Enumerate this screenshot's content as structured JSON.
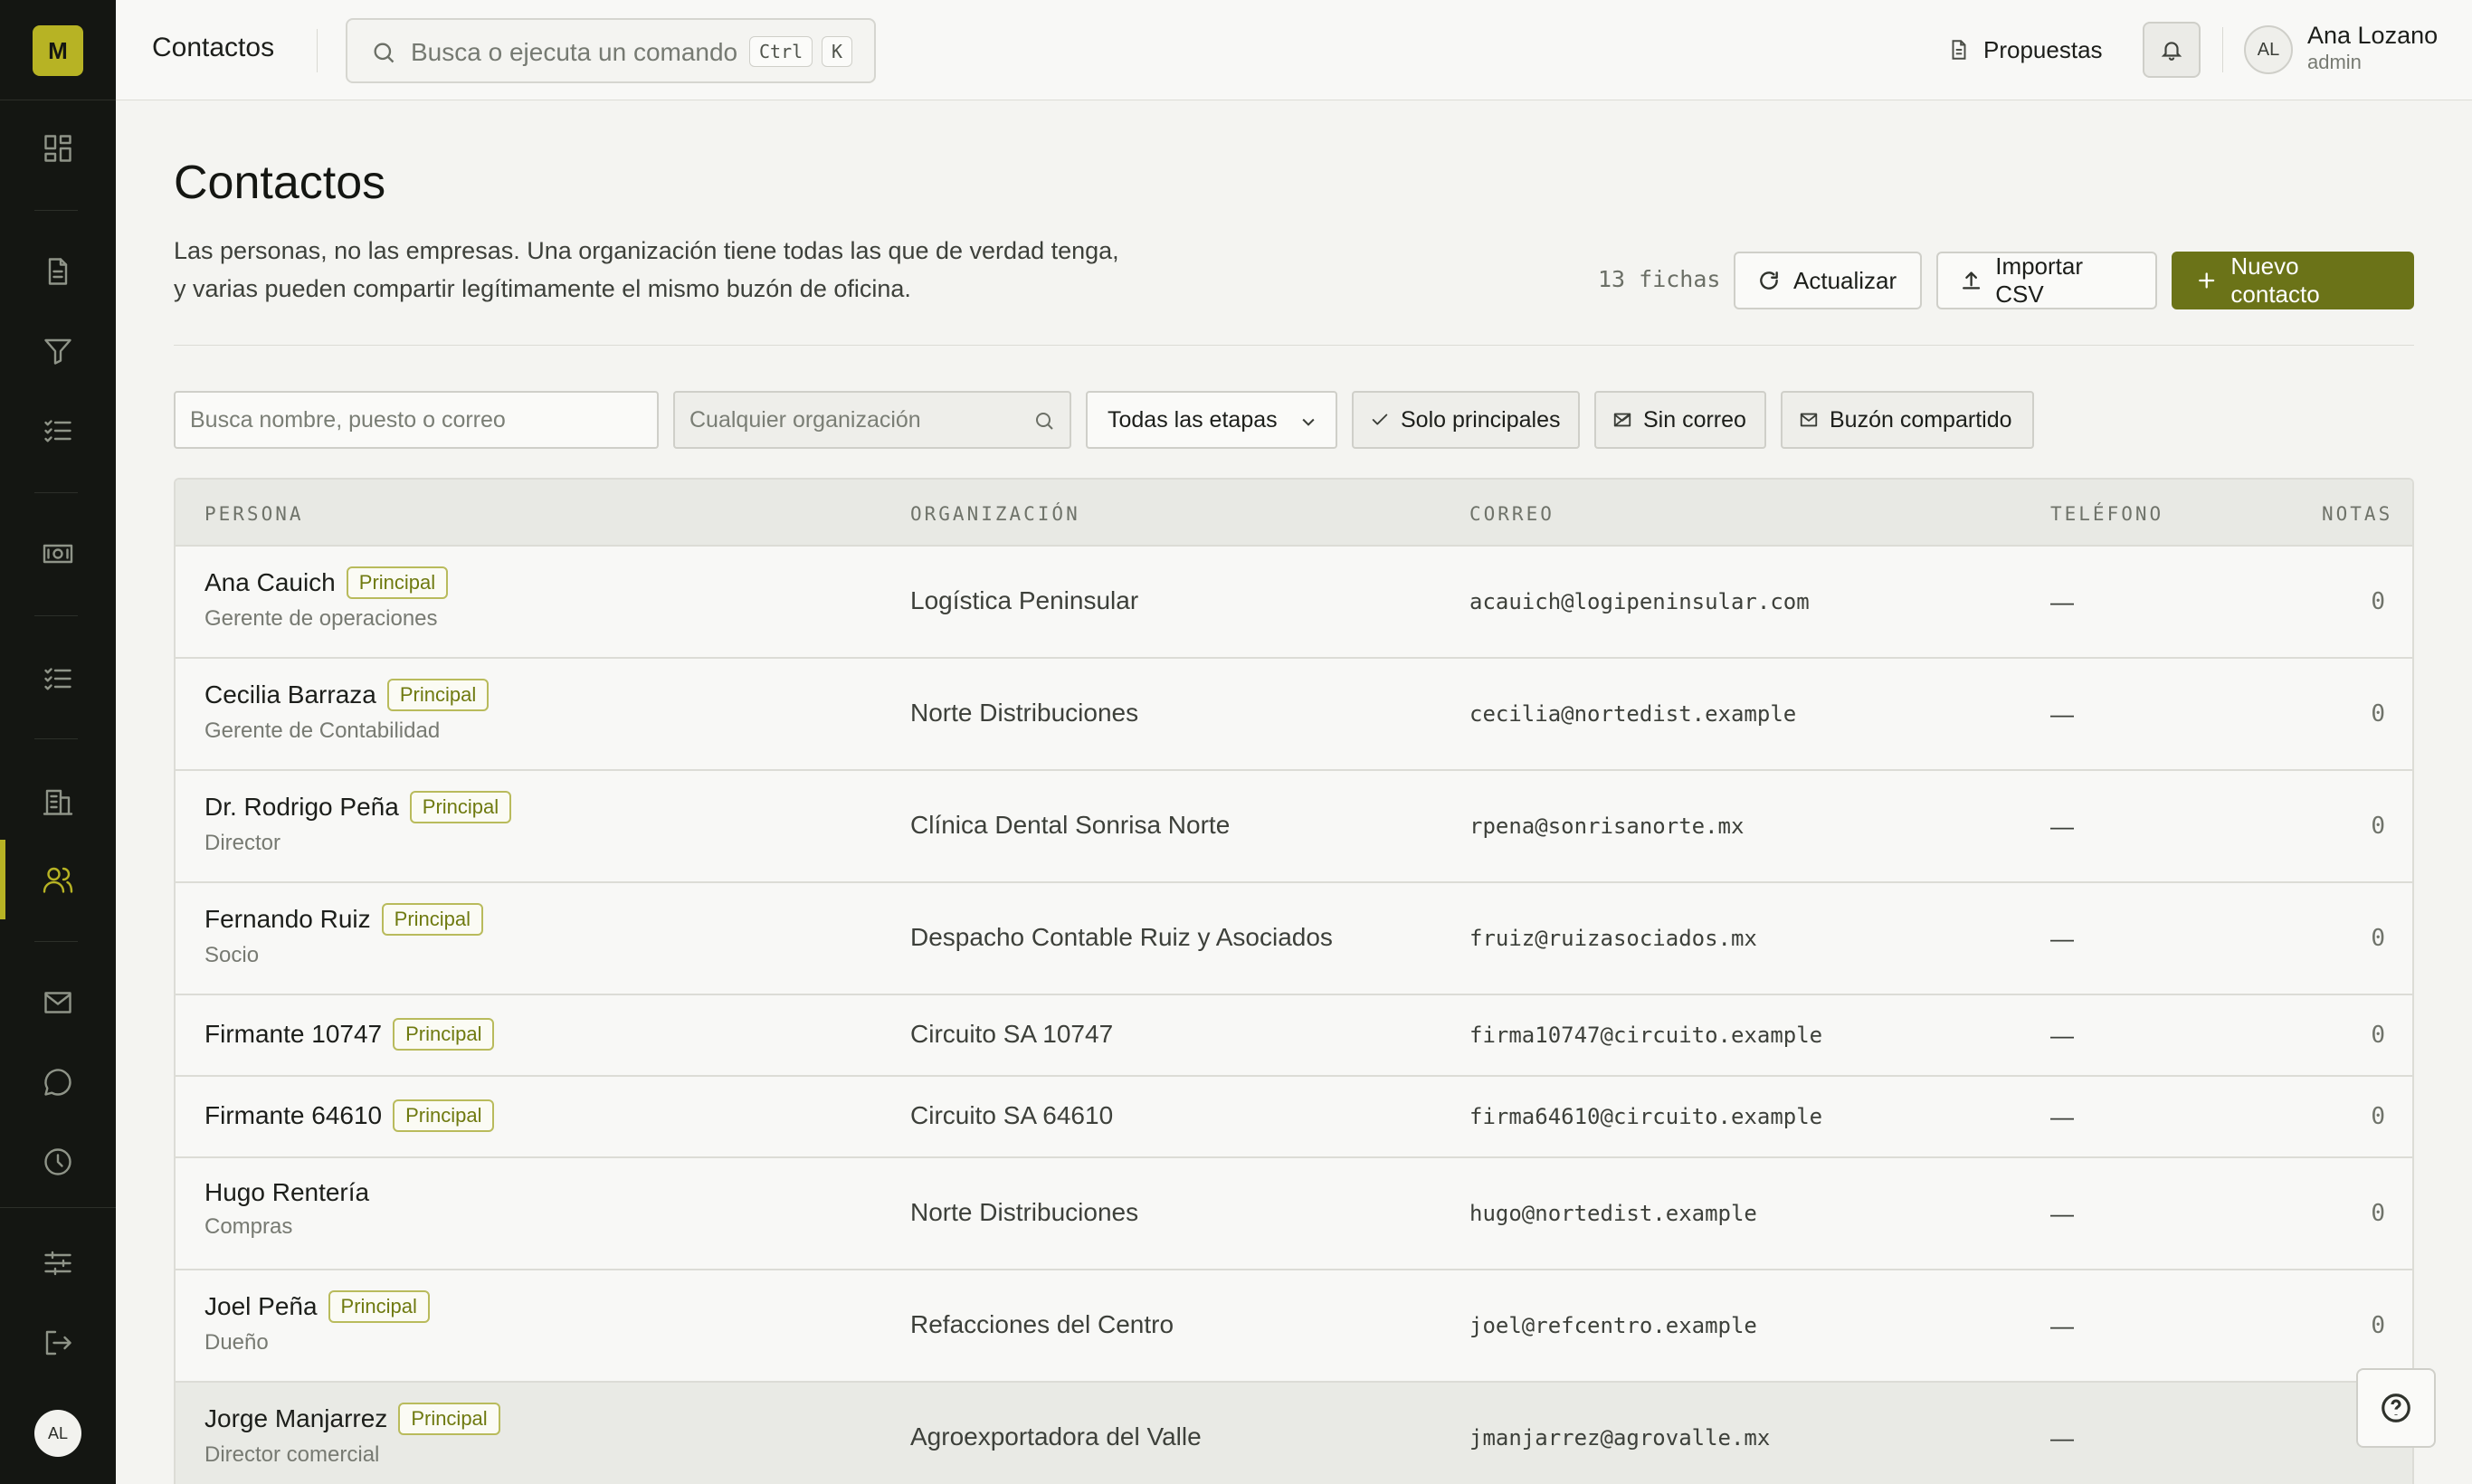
{
  "app": {
    "logo_letter": "M",
    "sidebar_avatar": "AL",
    "accent": "#b7b324",
    "primary_button_color": "#6b7318"
  },
  "sidebar": {
    "icons": [
      "dashboard-icon",
      "document-icon",
      "funnel-icon",
      "checklist-icon",
      "banknote-icon",
      "tasks-icon",
      "building-icon",
      "people-icon",
      "mail-icon",
      "chat-icon",
      "clock-icon",
      "sliders-icon",
      "logout-icon"
    ],
    "active": "people-icon"
  },
  "topbar": {
    "title": "Contactos",
    "search_placeholder": "Busca o ejecuta un comando",
    "shortcut_key1": "Ctrl",
    "shortcut_key2": "K",
    "proposals_label": "Propuestas",
    "user_initials": "AL",
    "user_name": "Ana Lozano",
    "user_role": "admin"
  },
  "page": {
    "title": "Contactos",
    "description": "Las personas, no las empresas. Una organización tiene todas las que de verdad tenga, y varias pueden compartir legítimamente el mismo buzón de oficina.",
    "count": "13 fichas",
    "refresh_label": "Actualizar",
    "import_label": "Importar CSV",
    "new_label": "Nuevo contacto"
  },
  "filters": {
    "search_placeholder": "Busca nombre, puesto o correo",
    "org_placeholder": "Cualquier organización",
    "stage_value": "Todas las etapas",
    "chip_primary": "Solo principales",
    "chip_no_email": "Sin correo",
    "chip_shared": "Buzón compartido"
  },
  "table": {
    "headers": {
      "person": "PERSONA",
      "org": "ORGANIZACIÓN",
      "email": "CORREO",
      "phone": "TELÉFONO",
      "notes": "NOTAS"
    },
    "badge_label": "Principal",
    "rows": [
      {
        "name": "Ana Cauich",
        "principal": true,
        "title": "Gerente de operaciones",
        "org": "Logística Peninsular",
        "email": "acauich@logipeninsular.com",
        "phone": "—",
        "notes": "0"
      },
      {
        "name": "Cecilia Barraza",
        "principal": true,
        "title": "Gerente de Contabilidad",
        "org": "Norte Distribuciones",
        "email": "cecilia@nortedist.example",
        "phone": "—",
        "notes": "0"
      },
      {
        "name": "Dr. Rodrigo Peña",
        "principal": true,
        "title": "Director",
        "org": "Clínica Dental Sonrisa Norte",
        "email": "rpena@sonrisanorte.mx",
        "phone": "—",
        "notes": "0"
      },
      {
        "name": "Fernando Ruiz",
        "principal": true,
        "title": "Socio",
        "org": "Despacho Contable Ruiz y Asociados",
        "email": "fruiz@ruizasociados.mx",
        "phone": "—",
        "notes": "0"
      },
      {
        "name": "Firmante 10747",
        "principal": true,
        "title": "",
        "org": "Circuito SA 10747",
        "email": "firma10747@circuito.example",
        "phone": "—",
        "notes": "0"
      },
      {
        "name": "Firmante 64610",
        "principal": true,
        "title": "",
        "org": "Circuito SA 64610",
        "email": "firma64610@circuito.example",
        "phone": "—",
        "notes": "0"
      },
      {
        "name": "Hugo Rentería",
        "principal": false,
        "title": "Compras",
        "org": "Norte Distribuciones",
        "email": "hugo@nortedist.example",
        "phone": "—",
        "notes": "0"
      },
      {
        "name": "Joel Peña",
        "principal": true,
        "title": "Dueño",
        "org": "Refacciones del Centro",
        "email": "joel@refcentro.example",
        "phone": "—",
        "notes": "0"
      },
      {
        "name": "Jorge Manjarrez",
        "principal": true,
        "title": "Director comercial",
        "org": "Agroexportadora del Valle",
        "email": "jmanjarrez@agrovalle.mx",
        "phone": "—",
        "notes": ""
      }
    ]
  }
}
